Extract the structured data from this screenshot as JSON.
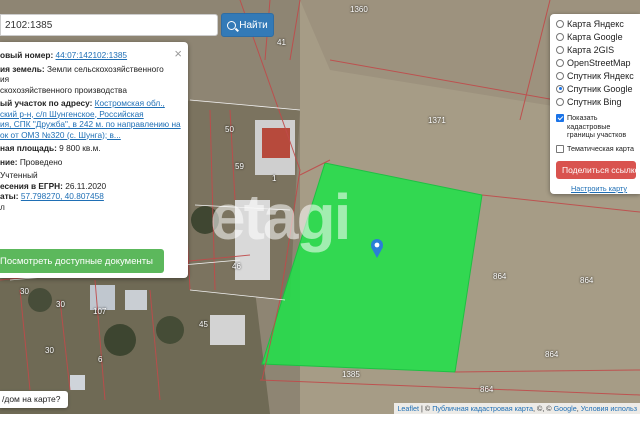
{
  "search": {
    "value": "2102:1385",
    "button_label": "Найти"
  },
  "popup": {
    "close_label": "×",
    "cad_label": "овый номер:",
    "cad_value": "44:07:142102:1385",
    "category_label": "ия земель:",
    "category_value_1": "Земли сельскохозяйственного",
    "category_value_2": "ия",
    "usage_value": "скохозяйственного производства",
    "address_label": "ый участок по адресу:",
    "address_1": "Костромская обл.,",
    "address_2": "ский р-н, с/п Шунгенское, Российская",
    "address_3": "ия, СПК \"Дружба\", в 242 м. по направлению на",
    "address_4": "ок от ОМЗ №320 (с. Шунга); в...",
    "area_label": "ная площадь:",
    "area_value": "9 800 кв.м.",
    "survey_label": "ние:",
    "survey_value": "Проведено",
    "status_value": "Учтенный",
    "egrn_label": "есения в ЕГРН:",
    "egrn_value": "26.11.2020",
    "coords_label": "аты:",
    "coords_value": "57.798270, 40.807458",
    "extra": "л",
    "docs_button": "Посмотреть доступные документы"
  },
  "layers": {
    "items": [
      {
        "label": "Карта Яндекс",
        "selected": false
      },
      {
        "label": "Карта Google",
        "selected": false
      },
      {
        "label": "Карта 2GIS",
        "selected": false
      },
      {
        "label": "OpenStreetMap",
        "selected": false
      },
      {
        "label": "Спутник Яндекс",
        "selected": false
      },
      {
        "label": "Спутник Google",
        "selected": true
      },
      {
        "label": "Спутник Bing",
        "selected": false
      }
    ],
    "show_borders_label": "Показать кадастровые границы участков",
    "thematic_label": "Тематическая карта",
    "share_button": "Поделиться ссылкой",
    "setup_link": "Настроить карту"
  },
  "map": {
    "watermark": "etagi",
    "parcel_labels": [
      "1360",
      "41",
      "1371",
      "50",
      "59",
      "1",
      "46",
      "864",
      "864",
      "864",
      "107",
      "6",
      "30",
      "30",
      "45",
      "1385",
      "864",
      "30"
    ]
  },
  "bottom": {
    "where_button": "/дом на карте?",
    "attribution_leaflet": "Leaflet",
    "attribution_pkk": "Публичная кадастровая карта",
    "attribution_google": "Google",
    "attribution_terms": "Условия использ"
  },
  "colors": {
    "parcel_fill": "#22e04a",
    "primary": "#337ab7",
    "success": "#5cb85c",
    "danger": "#d9534f"
  }
}
